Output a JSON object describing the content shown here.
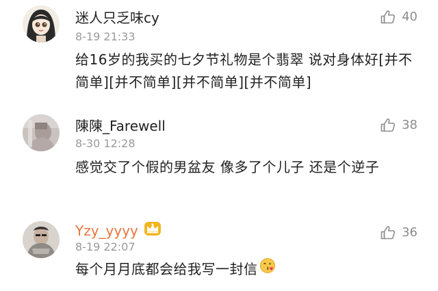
{
  "comments": [
    {
      "username": "迷人只乏味cy",
      "timestamp": "8-19 21:33",
      "likes": "40",
      "text": "给16岁的我买的七夕节礼物是个翡翠 说对身体好[并不简单][并不简单][并不简单][并不简单]",
      "avatar_icon": "girl-avatar"
    },
    {
      "username": "陳陳_Farewell",
      "timestamp": "8-30 12:28",
      "likes": "38",
      "text": "感觉交了个假的男盆友 像多了个儿子 还是个逆子",
      "avatar_icon": "photo-avatar"
    },
    {
      "username": "Yzy_yyyy",
      "timestamp": "8-19 22:07",
      "likes": "36",
      "text": "每个月月底都会给我写一封信",
      "avatar_icon": "photo-avatar",
      "badge_icon": "crown-icon",
      "emoji_icon": "kiss-emoji-icon"
    }
  ],
  "colors": {
    "username": "#222222",
    "vip_username": "#e8743b",
    "timestamp": "#9a9a9a",
    "like": "#8c8c8c"
  }
}
